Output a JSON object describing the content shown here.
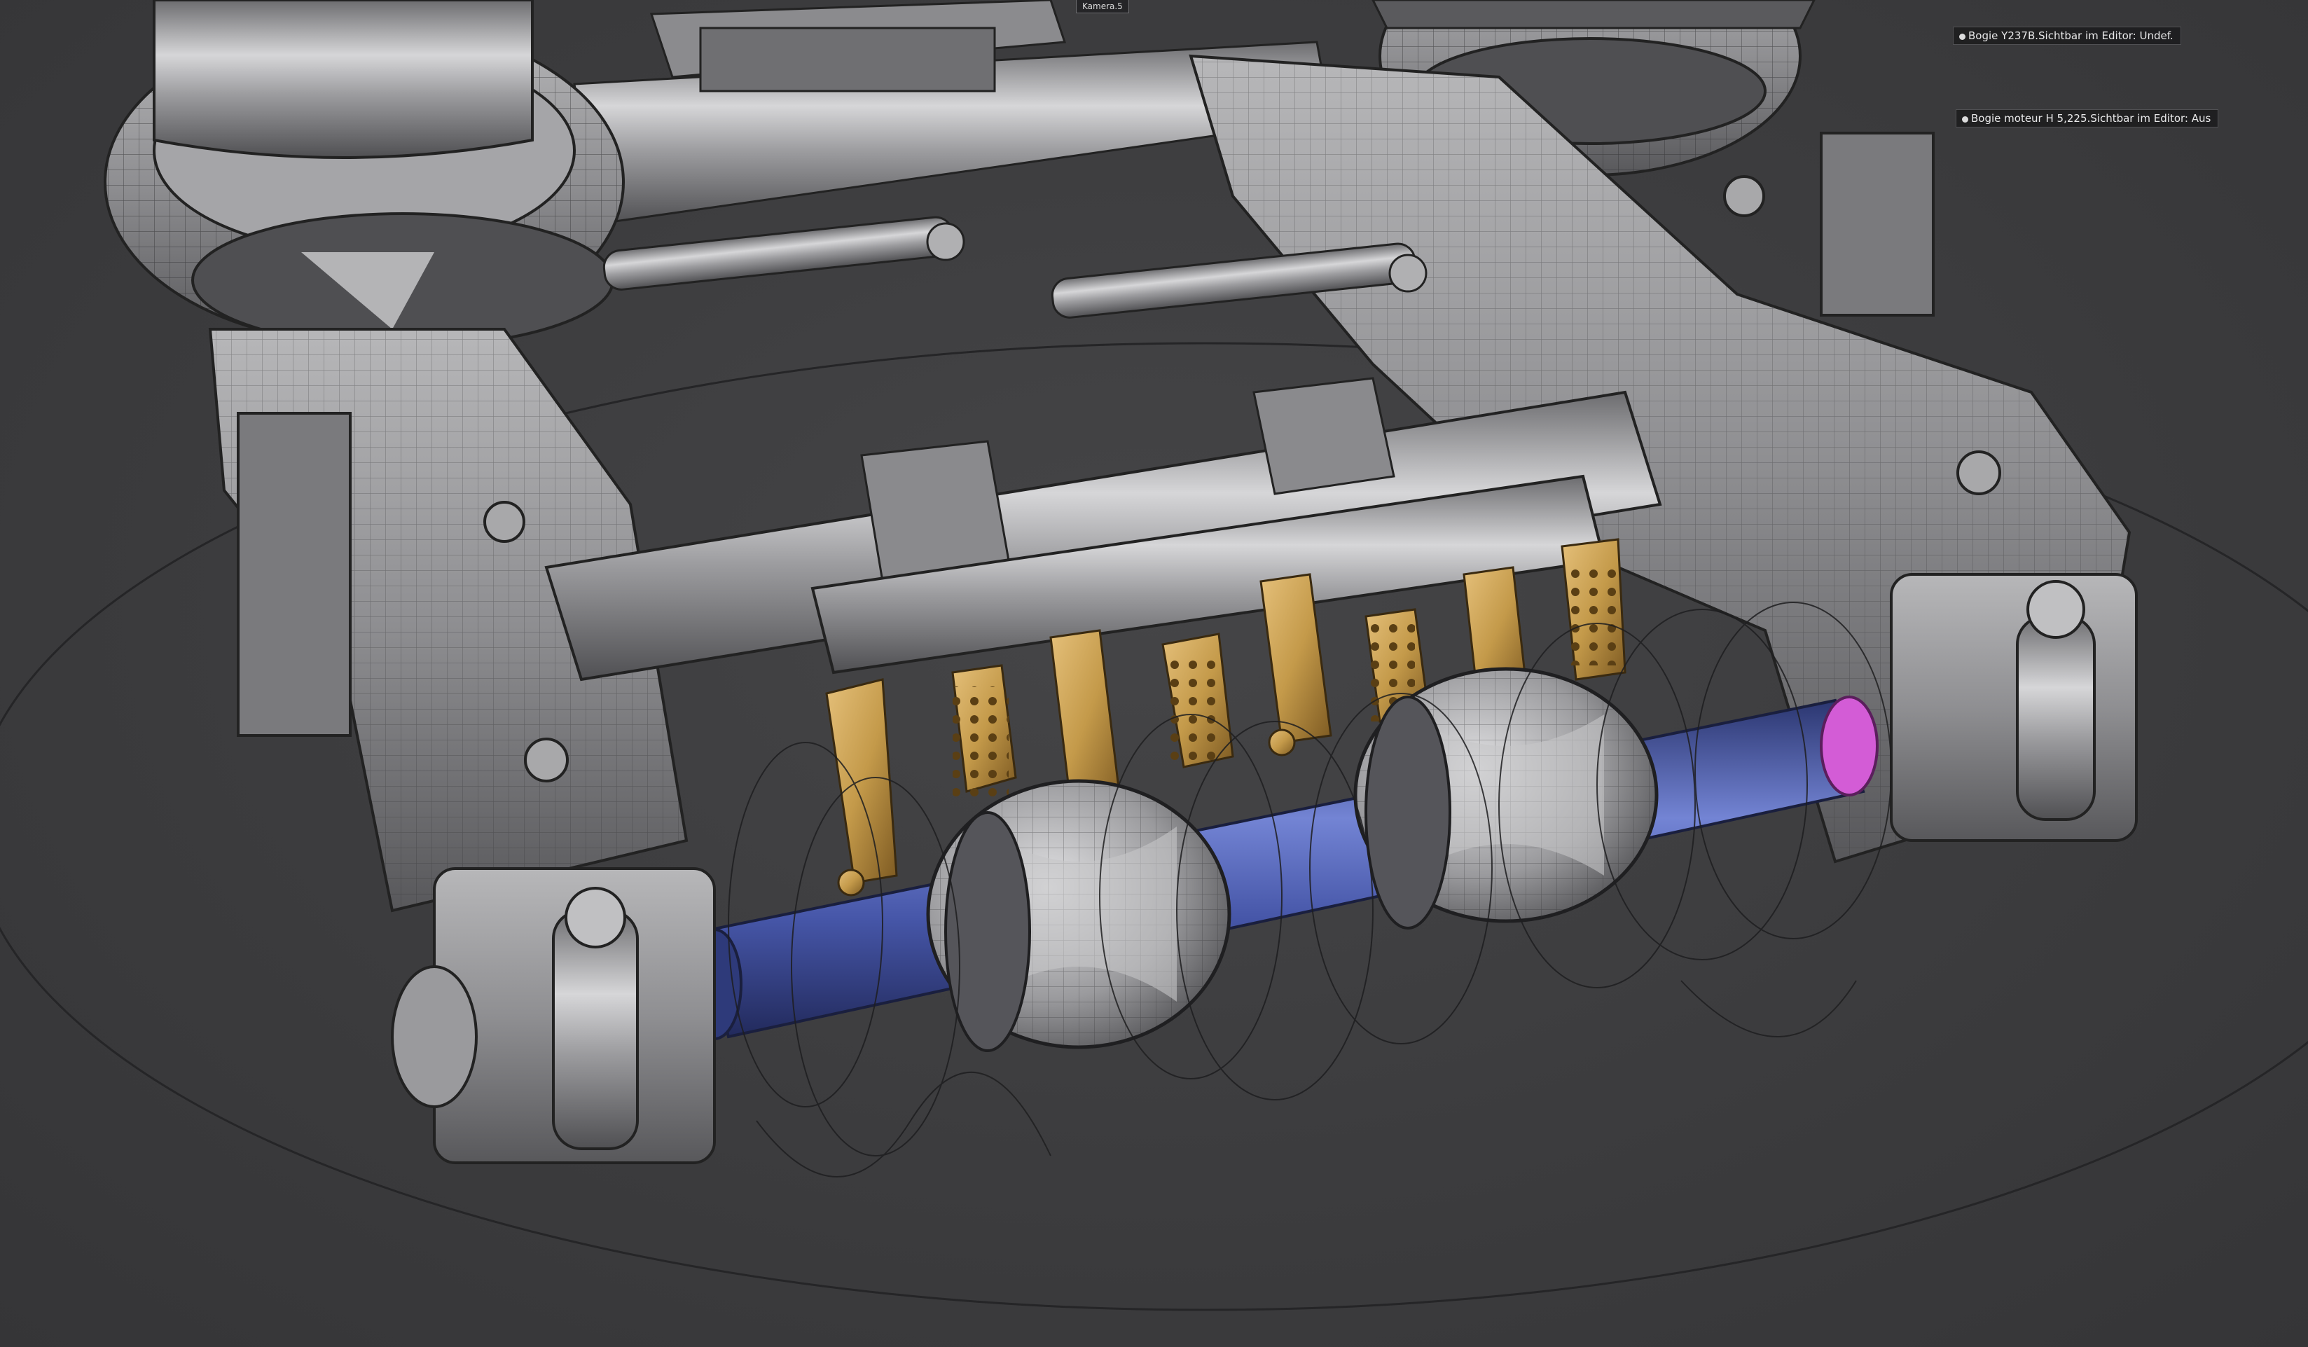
{
  "viewport": {
    "camera_label": "Kamera.5",
    "background_color": "#3c3c3e"
  },
  "hud": {
    "labels": [
      {
        "id": "bogie-y237b",
        "text": "Bogie Y237B.Sichtbar im Editor: Undef."
      },
      {
        "id": "bogie-moteur",
        "text": "Bogie moteur H 5,225.Sichtbar im Editor: Aus"
      }
    ]
  },
  "colors": {
    "metal_body": "#8e8e90",
    "metal_dark": "#5a5a5d",
    "brass": "#c49a4a",
    "axle_blue": "#3f4f9a",
    "axle_highlight": "#6f80d0",
    "selection_magenta": "#d35cd6",
    "wire": "#1e1e1e"
  }
}
